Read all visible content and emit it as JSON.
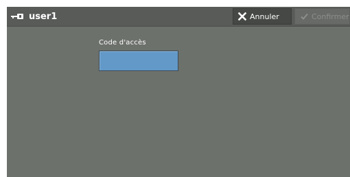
{
  "header": {
    "user_icon": "key-icon",
    "username": "user1"
  },
  "actions": {
    "cancel_label": "Annuler",
    "cancel_icon": "close-icon",
    "confirm_label": "Confirmer",
    "confirm_icon": "checkmark-icon",
    "confirm_enabled": false
  },
  "form": {
    "passcode_label": "Code d'accès",
    "passcode_value": ""
  },
  "colors": {
    "background": "#6d716c",
    "titlebar": "#585b58",
    "input_fill": "#6399c8"
  }
}
